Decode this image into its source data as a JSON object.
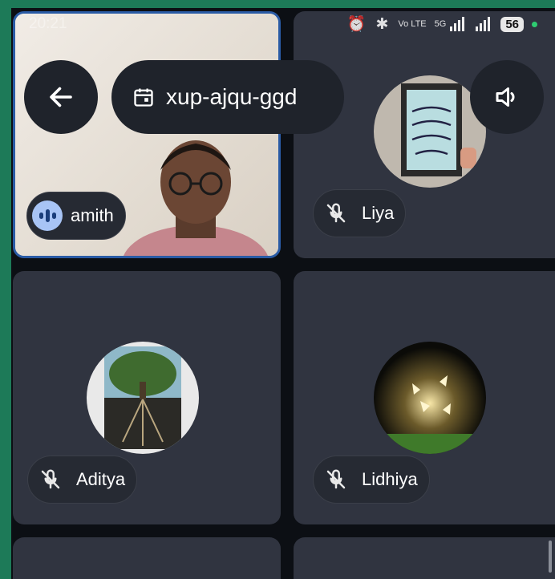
{
  "meeting": {
    "code": "xup-ajqu-ggd"
  },
  "status_bar": {
    "time": "20:21",
    "net_type": "Vo LTE",
    "net_5g": "5G",
    "battery": "56"
  },
  "participants": [
    {
      "name": "amith",
      "state": "speaking",
      "video": true
    },
    {
      "name": "Liya",
      "state": "muted",
      "video": false,
      "avatar": "progress-not-perfection-poster"
    },
    {
      "name": "Aditya",
      "state": "muted",
      "video": false,
      "avatar": "success-tree-poster"
    },
    {
      "name": "Lidhiya",
      "state": "muted",
      "video": false,
      "avatar": "glowing-butterflies-jar"
    }
  ],
  "icons": {
    "back": "arrow-left-icon",
    "calendar": "calendar-icon",
    "speaker": "speaker-icon",
    "muted": "mic-off-icon",
    "speaking": "audio-wave-icon"
  },
  "colors": {
    "background": "#0c0f14",
    "tile": "#303440",
    "pill": "#262a33",
    "speaking_badge": "#a8c4f5",
    "active_border": "#2a5ba5",
    "frame": "#1d7a58"
  }
}
